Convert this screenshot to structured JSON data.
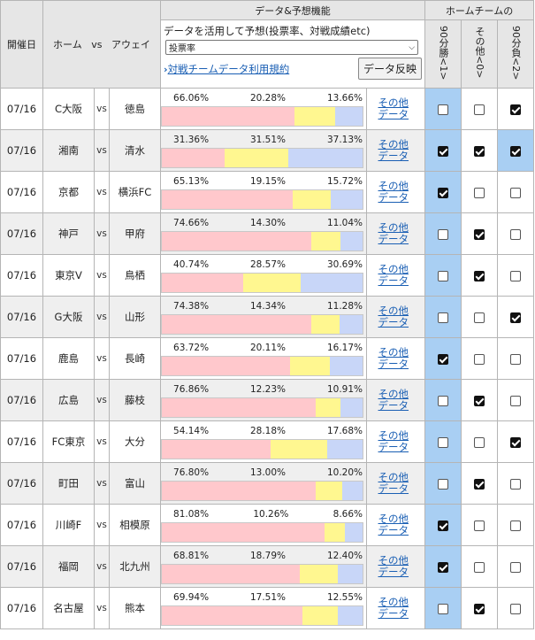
{
  "header": {
    "date_col": "開催日",
    "home_col": "ホーム",
    "vs_col": "vs",
    "away_col": "アウェイ",
    "data_title": "データ&予想機能",
    "home_team_title": "ホームチームの",
    "predict_label": "データを活用して予想(投票率、対戦成績etc)",
    "select_value": "投票率",
    "terms_link": "対戦チームデータ利用規約",
    "apply_button": "データ反映",
    "col_win": "90分勝<1>",
    "col_other": "その他<0>",
    "col_lose": "90分負<2>"
  },
  "row_link_text": "その他データ",
  "rows": [
    {
      "date": "07/16",
      "home": "C大阪",
      "vs": "vs",
      "away": "徳島",
      "p1": "66.06%",
      "p0": "20.28%",
      "p2": "13.66%",
      "v1": 66.06,
      "v0": 20.28,
      "v2": 13.66,
      "c": [
        false,
        false,
        true
      ]
    },
    {
      "date": "07/16",
      "home": "湘南",
      "vs": "vs",
      "away": "清水",
      "p1": "31.36%",
      "p0": "31.51%",
      "p2": "37.13%",
      "v1": 31.36,
      "v0": 31.51,
      "v2": 37.13,
      "c": [
        true,
        true,
        true
      ]
    },
    {
      "date": "07/16",
      "home": "京都",
      "vs": "vs",
      "away": "横浜FC",
      "p1": "65.13%",
      "p0": "19.15%",
      "p2": "15.72%",
      "v1": 65.13,
      "v0": 19.15,
      "v2": 15.72,
      "c": [
        true,
        false,
        false
      ]
    },
    {
      "date": "07/16",
      "home": "神戸",
      "vs": "vs",
      "away": "甲府",
      "p1": "74.66%",
      "p0": "14.30%",
      "p2": "11.04%",
      "v1": 74.66,
      "v0": 14.3,
      "v2": 11.04,
      "c": [
        false,
        true,
        false
      ]
    },
    {
      "date": "07/16",
      "home": "東京V",
      "vs": "vs",
      "away": "鳥栖",
      "p1": "40.74%",
      "p0": "28.57%",
      "p2": "30.69%",
      "v1": 40.74,
      "v0": 28.57,
      "v2": 30.69,
      "c": [
        false,
        true,
        false
      ]
    },
    {
      "date": "07/16",
      "home": "G大阪",
      "vs": "vs",
      "away": "山形",
      "p1": "74.38%",
      "p0": "14.34%",
      "p2": "11.28%",
      "v1": 74.38,
      "v0": 14.34,
      "v2": 11.28,
      "c": [
        false,
        false,
        true
      ]
    },
    {
      "date": "07/16",
      "home": "鹿島",
      "vs": "vs",
      "away": "長崎",
      "p1": "63.72%",
      "p0": "20.11%",
      "p2": "16.17%",
      "v1": 63.72,
      "v0": 20.11,
      "v2": 16.17,
      "c": [
        true,
        false,
        false
      ]
    },
    {
      "date": "07/16",
      "home": "広島",
      "vs": "vs",
      "away": "藤枝",
      "p1": "76.86%",
      "p0": "12.23%",
      "p2": "10.91%",
      "v1": 76.86,
      "v0": 12.23,
      "v2": 10.91,
      "c": [
        false,
        true,
        false
      ]
    },
    {
      "date": "07/16",
      "home": "FC東京",
      "vs": "vs",
      "away": "大分",
      "p1": "54.14%",
      "p0": "28.18%",
      "p2": "17.68%",
      "v1": 54.14,
      "v0": 28.18,
      "v2": 17.68,
      "c": [
        false,
        false,
        true
      ]
    },
    {
      "date": "07/16",
      "home": "町田",
      "vs": "vs",
      "away": "富山",
      "p1": "76.80%",
      "p0": "13.00%",
      "p2": "10.20%",
      "v1": 76.8,
      "v0": 13.0,
      "v2": 10.2,
      "c": [
        false,
        true,
        false
      ]
    },
    {
      "date": "07/16",
      "home": "川崎F",
      "vs": "vs",
      "away": "相模原",
      "p1": "81.08%",
      "p0": "10.26%",
      "p2": "8.66%",
      "v1": 81.08,
      "v0": 10.26,
      "v2": 8.66,
      "c": [
        true,
        false,
        false
      ]
    },
    {
      "date": "07/16",
      "home": "福岡",
      "vs": "vs",
      "away": "北九州",
      "p1": "68.81%",
      "p0": "18.79%",
      "p2": "12.40%",
      "v1": 68.81,
      "v0": 18.79,
      "v2": 12.4,
      "c": [
        true,
        false,
        false
      ]
    },
    {
      "date": "07/16",
      "home": "名古屋",
      "vs": "vs",
      "away": "熊本",
      "p1": "69.94%",
      "p0": "17.51%",
      "p2": "12.55%",
      "v1": 69.94,
      "v0": 17.51,
      "v2": 12.55,
      "c": [
        false,
        true,
        false
      ]
    }
  ],
  "colors": {
    "home_bar": "#ffc8cc",
    "draw_bar": "#fff790",
    "away_bar": "#c8d6f8",
    "win_col_bg": "#a9cff3",
    "link": "#1a5fb4"
  }
}
